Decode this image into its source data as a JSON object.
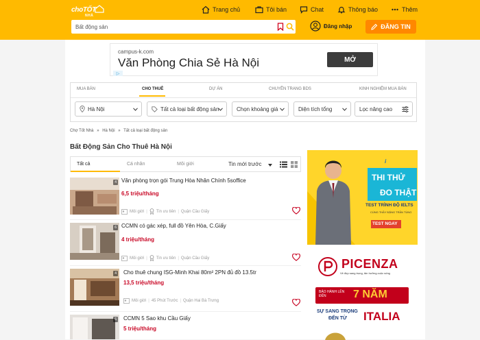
{
  "header": {
    "logo_top": "choTỐT",
    "logo_bottom": "NHÀ",
    "nav": [
      {
        "label": "Trang chủ",
        "icon": "home-icon"
      },
      {
        "label": "Tôi bán",
        "icon": "briefcase-icon"
      },
      {
        "label": "Chat",
        "icon": "chat-icon"
      },
      {
        "label": "Thông báo",
        "icon": "bell-icon"
      },
      {
        "label": "Thêm",
        "icon": "more-icon"
      }
    ],
    "search_placeholder": "Bất động sản",
    "login_label": "Đăng nhập",
    "post_label": "ĐĂNG TIN"
  },
  "top_ad": {
    "domain": "campus-k.com",
    "headline": "Văn Phòng Chia Sẻ Hà Nội",
    "cta": "MỞ"
  },
  "filter": {
    "tabs": [
      "MUA BÁN",
      "CHO THUÊ",
      "DỰ ÁN",
      "CHUYÊN TRANG BDS",
      "KINH NGHIỆM MUA BÁN"
    ],
    "active_tab": "CHO THUÊ",
    "location": "Hà Nội",
    "type": "Tất cả loại bất động sản",
    "price": "Chọn khoảng giá",
    "area": "Diện tích tổng",
    "advanced": "Lọc nâng cao"
  },
  "breadcrumb": [
    "Chợ Tốt Nhà",
    "»",
    "Hà Nội",
    "»",
    "Tất cả loại bất động sản"
  ],
  "page_title": "Bất Động Sản Cho Thuê Hà Nội",
  "list_tabs": {
    "items": [
      "Tất cả",
      "Cá nhân",
      "Môi giới"
    ],
    "sort": "Tin mới trước"
  },
  "listings": [
    {
      "title": "Văn phòng trọn gói Trung Hòa Nhân Chính 5soffice",
      "price": "6,5 triệu/tháng",
      "photos": "4",
      "seller": "Môi giới",
      "badge": "Tin ưu tiên",
      "location": "Quận Cầu Giấy"
    },
    {
      "title": "CCMN có gác xép, full đồ Yên Hòa, C.Giấy",
      "price": "4 triệu/tháng",
      "photos": "6",
      "seller": "Môi giới",
      "badge": "Tin ưu tiên",
      "location": "Quận Cầu Giấy"
    },
    {
      "title": "Cho thuê chung ISG-Minh Khai 80m² 2PN đủ đồ 13.5tr",
      "price": "13,5 triệu/tháng",
      "photos": "4",
      "seller": "Môi giới",
      "badge": "45 Phút Trước",
      "location": "Quận Hai Bà Trưng"
    },
    {
      "title": "CCMN 5 Sao khu Cầu Giấy",
      "price": "5 triệu/tháng",
      "photos": "6",
      "seller": "",
      "badge": "",
      "location": ""
    }
  ],
  "side_ad": {
    "brand": "i",
    "line1": "THI THỬ",
    "line2": "ĐO THẬT",
    "line3": "TEST TRÌNH ĐỘ IELTS",
    "line4": "CÙNG THẦY ĐẶNG TRẦN TÙNG",
    "cta": "TEST NGAY"
  },
  "side_ad2": {
    "brand": "PICENZA",
    "tagline": "Vẻ đẹp sang trọng, tân hưởng cuộc sống",
    "badge_text": "BẢO HÀNH LÊN ĐẾN",
    "years": "7 NĂM",
    "line_a": "SỰ SANG TRỌNG",
    "line_b": "ĐẾN TỪ",
    "country": "ITALIA"
  },
  "colors": {
    "brand": "#ffba00",
    "accent": "#ff8800",
    "price": "#c90927"
  }
}
